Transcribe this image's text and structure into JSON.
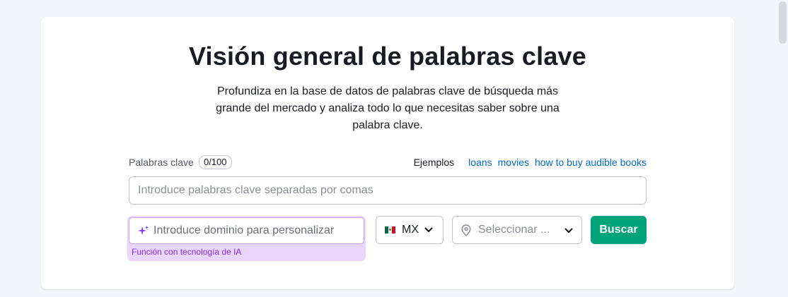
{
  "header": {
    "title": "Visión general de palabras clave",
    "subtitle": "Profundiza en la base de datos de palabras clave de búsqueda más grande del mercado y analiza todo lo que necesitas saber sobre una palabra clave."
  },
  "keywords": {
    "label": "Palabras clave",
    "counter": "0/100",
    "placeholder": "Introduce palabras clave separadas por comas",
    "value": ""
  },
  "examples": {
    "label": "Ejemplos",
    "items": [
      "loans",
      "movies",
      "how to buy audible books"
    ]
  },
  "domain": {
    "placeholder": "Introduce dominio para personalizar",
    "value": "",
    "ai_note": "Función con tecnología de IA",
    "icon": "sparkle-icon"
  },
  "country": {
    "code": "MX",
    "flag_icon": "mexico-flag-icon"
  },
  "location": {
    "placeholder": "Seleccionar ...",
    "icon": "location-pin-icon"
  },
  "search_button": {
    "label": "Buscar",
    "color": "#00a37a"
  },
  "colors": {
    "accent_link": "#006dca",
    "ai_purple": "#7d2ee0",
    "ai_background": "#ead5fc"
  }
}
